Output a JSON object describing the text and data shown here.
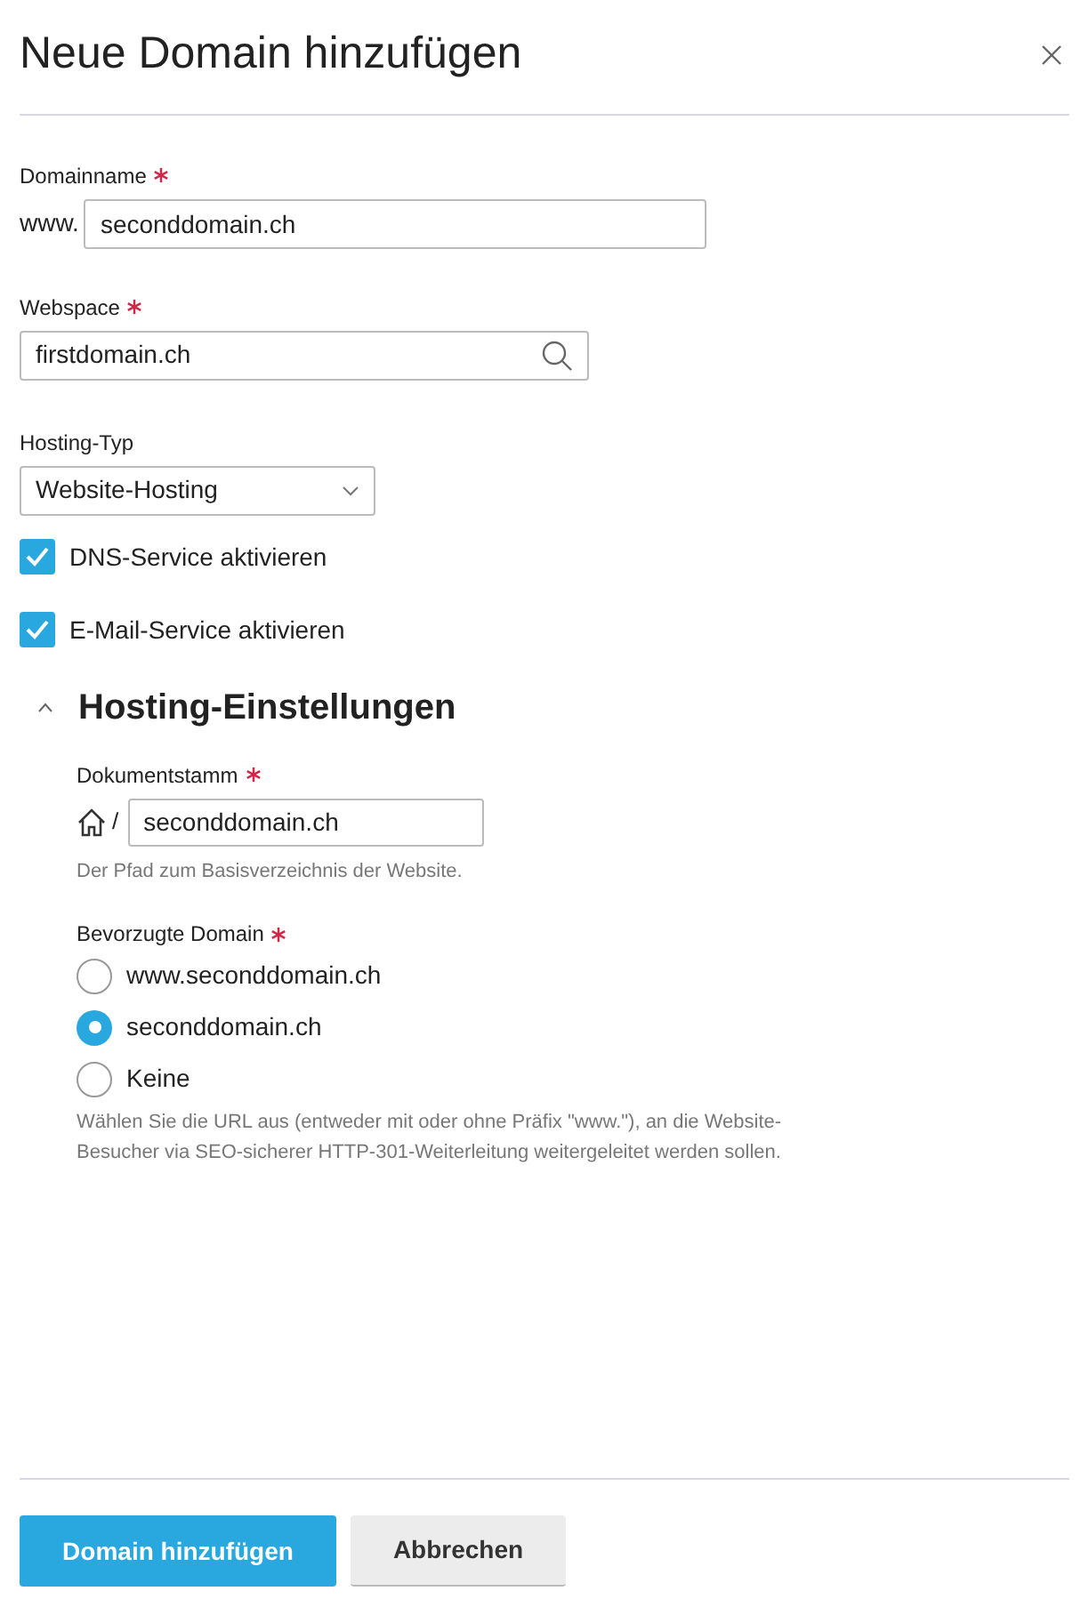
{
  "dialog": {
    "title": "Neue Domain hinzufügen"
  },
  "domain_name": {
    "label": "Domainname",
    "required": true,
    "prefix": "www.",
    "value": "seconddomain.ch"
  },
  "webspace": {
    "label": "Webspace",
    "required": true,
    "value": "firstdomain.ch"
  },
  "hosting_type": {
    "label": "Hosting-Typ",
    "value": "Website-Hosting"
  },
  "options": [
    {
      "label": "DNS-Service aktivieren",
      "checked": true
    },
    {
      "label": "E-Mail-Service aktivieren",
      "checked": true
    }
  ],
  "hosting_settings": {
    "title": "Hosting-Einstellungen",
    "expanded": true,
    "document_root": {
      "label": "Dokumentstamm",
      "required": true,
      "separator": "/",
      "value": "seconddomain.ch",
      "hint": "Der Pfad zum Basisverzeichnis der Website."
    },
    "preferred_domain": {
      "label": "Bevorzugte Domain",
      "required": true,
      "options": [
        {
          "label": "www.seconddomain.ch",
          "selected": false
        },
        {
          "label": "seconddomain.ch",
          "selected": true
        },
        {
          "label": "Keine",
          "selected": false
        }
      ],
      "hint": "Wählen Sie die URL aus (entweder mit oder ohne Präfix \"www.\"), an die Website-Besucher via SEO-sicherer HTTP-301-Weiterleitung weitergeleitet werden sollen."
    }
  },
  "buttons": [
    {
      "label": "Domain hinzufügen",
      "kind": "primary"
    },
    {
      "label": "Abbrechen",
      "kind": "secondary"
    }
  ]
}
